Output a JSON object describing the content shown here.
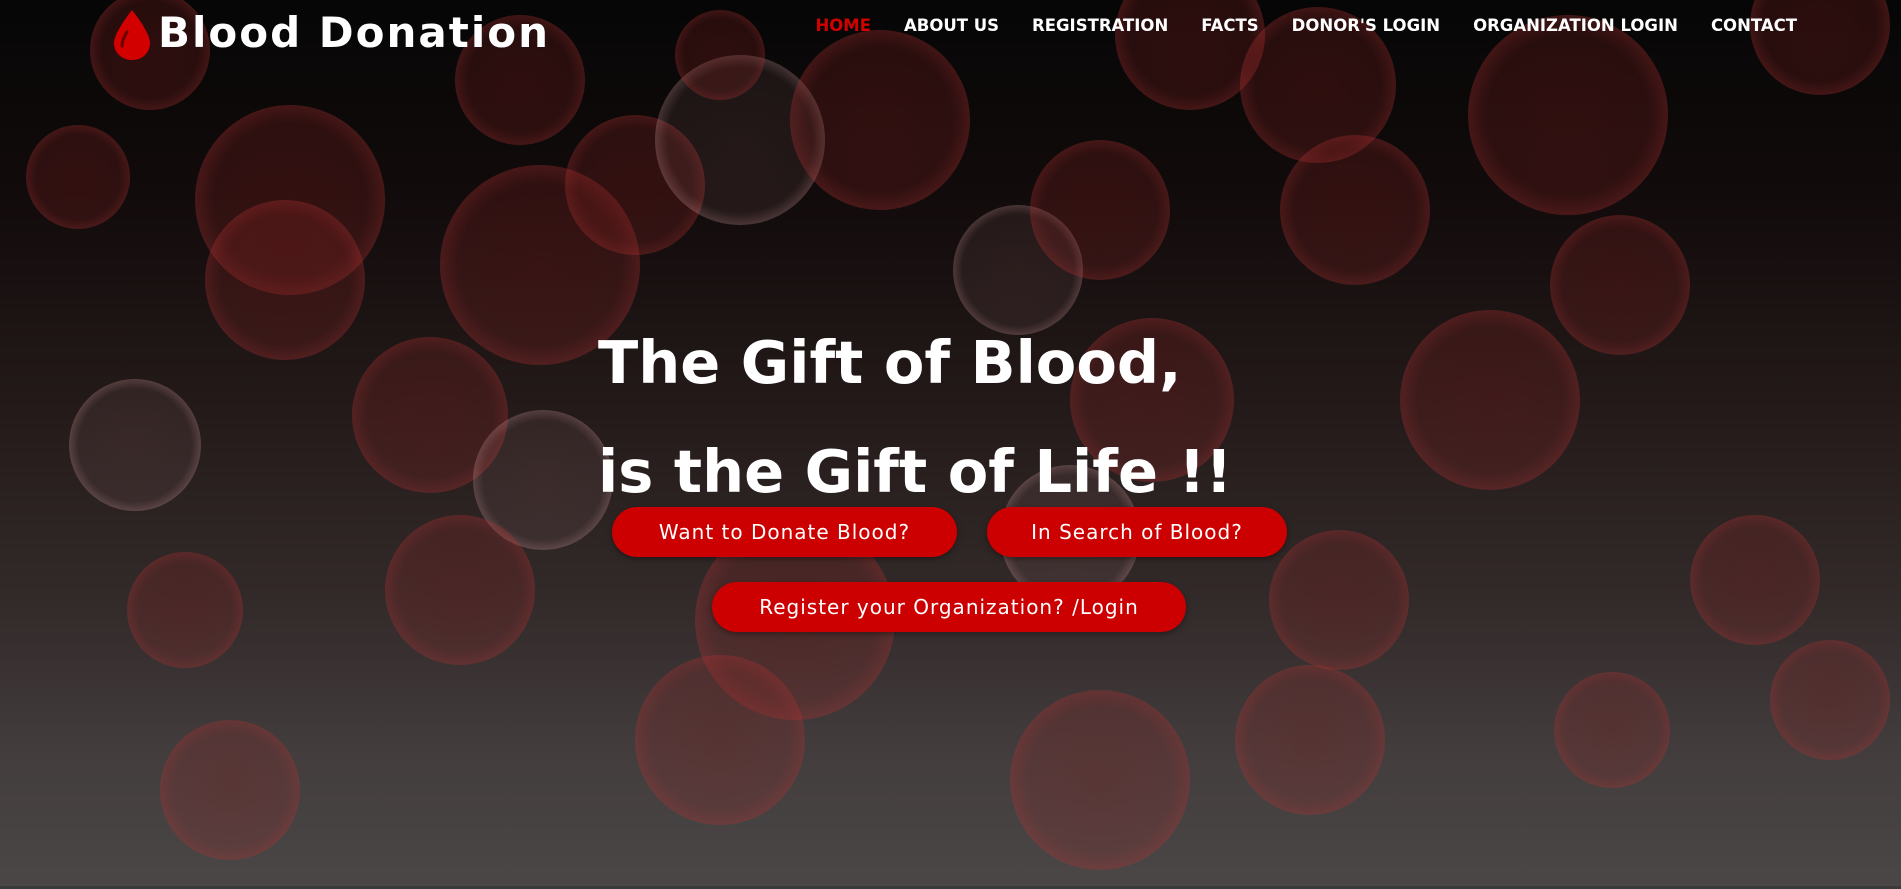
{
  "brand": {
    "name": "Blood Donation",
    "accent_color": "#cc0000",
    "icon": "blood-drop-icon"
  },
  "nav": {
    "items": [
      {
        "label": "HOME",
        "active": true
      },
      {
        "label": "ABOUT US",
        "active": false
      },
      {
        "label": "REGISTRATION",
        "active": false
      },
      {
        "label": "FACTS",
        "active": false
      },
      {
        "label": "DONOR'S LOGIN",
        "active": false
      },
      {
        "label": "ORGANIZATION LOGIN",
        "active": false
      },
      {
        "label": "CONTACT",
        "active": false
      }
    ],
    "active_color": "#d30000"
  },
  "hero": {
    "headline_line1": "The Gift of Blood,",
    "headline_line2": "is the Gift of Life !!",
    "buttons": {
      "donate": "Want to Donate Blood?",
      "search": "In Search of Blood?",
      "organization": "Register your Organization? /Login"
    }
  }
}
